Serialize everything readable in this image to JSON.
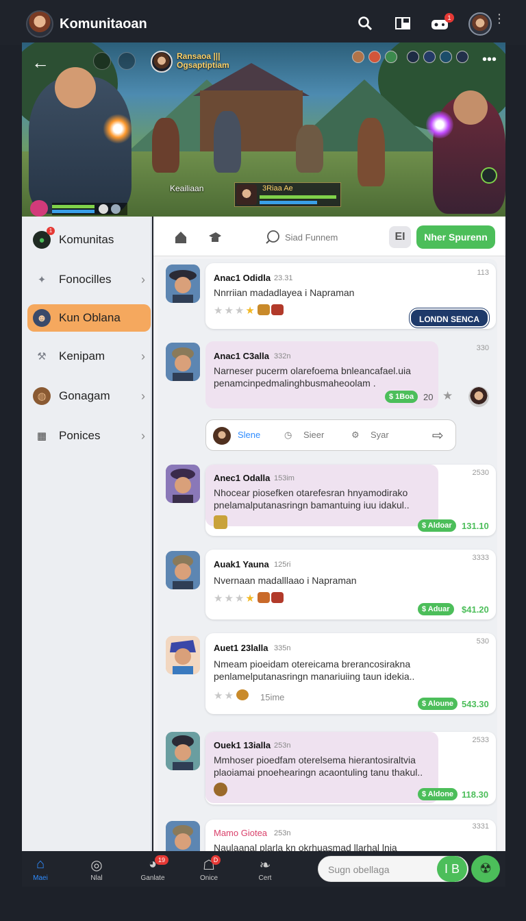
{
  "app": {
    "title": "Komunitaoan"
  },
  "topbar": {
    "icons": [
      "search-icon",
      "layout-icon",
      "gamepad-icon",
      "profile-avatar",
      "more-vertical-icon"
    ],
    "gamepad_badge": "1"
  },
  "banner": {
    "title_line1": "Ransaoa  |||",
    "title_line2": "Ogsaptiptiam",
    "hud_label": "Keailiaan",
    "hud_text": "3Riaa  Ae",
    "icons": [
      "back-arrow-icon",
      "more-horizontal-icon"
    ]
  },
  "sidebar": {
    "items": [
      {
        "label": "Komunitas",
        "icon": "community-icon",
        "badge": "1",
        "active": false,
        "chevron": false
      },
      {
        "label": "Fonocilles",
        "icon": "shield-icon",
        "active": false,
        "chevron": true
      },
      {
        "label": "Kun Oblana",
        "icon": "user-icon",
        "active": true,
        "chevron": false
      },
      {
        "label": "Kenipam",
        "icon": "wrench-icon",
        "active": false,
        "chevron": true
      },
      {
        "label": "Gonagam",
        "icon": "bag-icon",
        "active": false,
        "chevron": true
      },
      {
        "label": "Ponices",
        "icon": "grid-icon",
        "active": false,
        "chevron": true
      }
    ]
  },
  "toolbar": {
    "search_label": "Siad Funnem",
    "filter_label": "EI",
    "join_label": "Nher Spurenn"
  },
  "posts": [
    {
      "name": "Anac1 Odidla",
      "time": "23.31",
      "num": "113",
      "text": "Nnrriian madadlayea i Napraman",
      "button": "LONDN SENCA"
    },
    {
      "name": "Anac1 C3alla",
      "time": "332n",
      "num": "330",
      "text": "Narneser pucerm olarefoema bnleancafael.uia penamcinpedmalinghbusmaheoolam .",
      "pill": "$ 1Boa",
      "count": "20"
    },
    {
      "name": "Anec1 Odalla",
      "time": "153im",
      "num": "2530",
      "text": "Nhocear piosefken otarefesran hnyamodirako pnelamalputanasringn bamantuing iuu idakul..",
      "pill": "$ Aldoar",
      "price": "131.10"
    },
    {
      "name": "Auak1 Yauna",
      "time": "125ri",
      "num": "3333",
      "text": "Nvernaan madalllaao i Napraman",
      "pill": "$ Aduar",
      "price": "$41.20"
    },
    {
      "name": "Auet1 23lalla",
      "time": "335n",
      "num": "530",
      "text": "Nmeam pioeidam otereicama brerancosirakna penlamelputanasringn manariuiing taun idekia..",
      "pill": "$ Aloune",
      "price": "543.30",
      "stars_note": "15ime"
    },
    {
      "name": "Ouek1 13ialla",
      "time": "253n",
      "num": "2533",
      "text": "Mmhoser pioedfam oterelsema hierantosiraltvia plaoiamai pnoehearingn acaontuling tanu thakul..",
      "pill": "$ Aldone",
      "price": "118.30"
    },
    {
      "name": "Mamo Giotea",
      "time": "253n",
      "num": "3331",
      "text": "Naulaanal  plarla kn okrhuasmad llarhal  lnia"
    }
  ],
  "actions": {
    "a1": "Slene",
    "a2": "Sieer",
    "a3": "Syar"
  },
  "bottom_nav": [
    {
      "label": "Maei",
      "icon": "home-icon",
      "active": true
    },
    {
      "label": "Nlal",
      "icon": "target-icon"
    },
    {
      "label": "Ganlate",
      "icon": "game-icon",
      "badge": "19"
    },
    {
      "label": "Onice",
      "icon": "chat-icon",
      "badge": "D"
    },
    {
      "label": "Cert",
      "icon": "leaf-icon"
    }
  ],
  "chat": {
    "placeholder": "Sugn obellaga",
    "send_label": "I B"
  },
  "colors": {
    "accent_green": "#4cbe5a",
    "active_orange": "#f5a85e",
    "dark_blue": "#1e3a6a",
    "bubble_pink": "#efe2f0"
  }
}
